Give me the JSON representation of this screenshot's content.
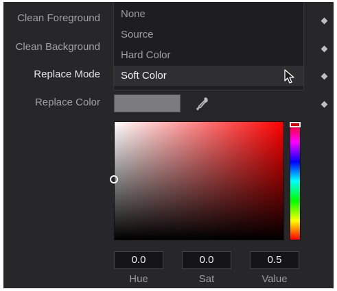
{
  "labels": {
    "clean_foreground": "Clean Foreground",
    "clean_background": "Clean Background",
    "replace_mode": "Replace Mode",
    "replace_color": "Replace Color"
  },
  "dropdown": {
    "options": [
      "None",
      "Source",
      "Hard Color",
      "Soft Color"
    ],
    "selected": "Soft Color"
  },
  "icons": {
    "keyframe": "diamond-icon",
    "eyedropper": "eyedropper-icon",
    "cursor": "mouse-pointer-icon"
  },
  "replace_color_swatch": "#7c7c7e",
  "color_picker": {
    "hue": {
      "value": "0.0",
      "label": "Hue"
    },
    "sat": {
      "value": "0.0",
      "label": "Sat"
    },
    "value": {
      "value": "0.5",
      "label": "Value"
    }
  },
  "colors": {
    "panel_bg": "#27272a",
    "text_dim": "#a2a2a2",
    "text_bright": "#f2f2f2"
  }
}
